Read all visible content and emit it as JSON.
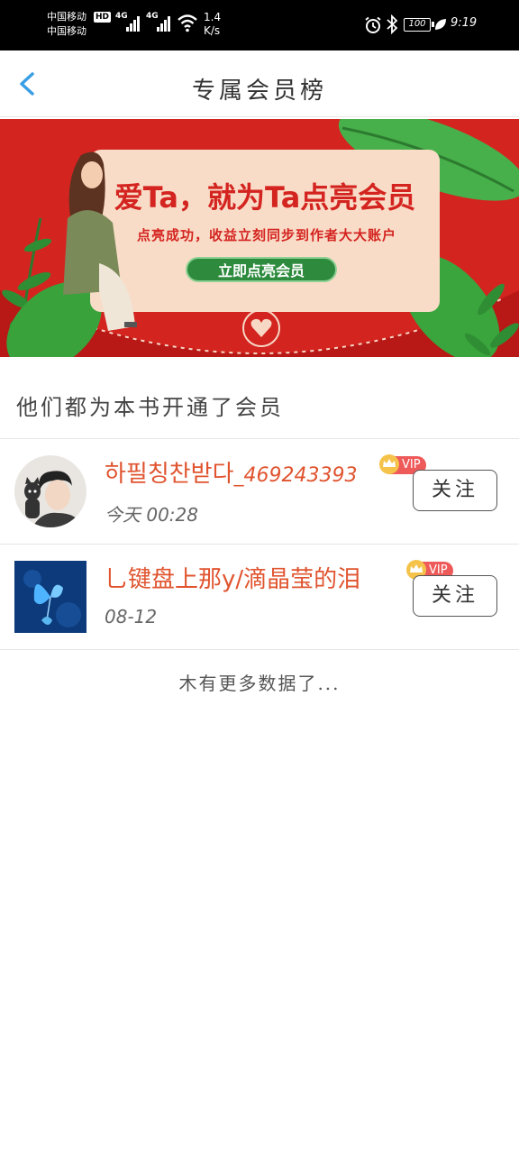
{
  "status_bar": {
    "carrier_1": "中国移动",
    "carrier_2": "中国移动",
    "hd": "HD",
    "network_1": "4G",
    "network_2": "4G",
    "speed_value": "1.4",
    "speed_unit": "K/s",
    "battery": "100",
    "time": "9:19",
    "icons": [
      "signal-icon",
      "wifi-icon",
      "alarm-icon",
      "bluetooth-icon",
      "battery-icon",
      "leaf-icon"
    ]
  },
  "header": {
    "title": "专属会员榜",
    "back_icon": "chevron-left-icon"
  },
  "banner": {
    "headline": "爱Ta，就为Ta点亮会员",
    "subtitle": "点亮成功，收益立刻同步到作者大大账户",
    "cta": "立即点亮会员",
    "colors": {
      "background": "#d42420",
      "card": "#f9dcc7",
      "cta": "#2e8b3e"
    }
  },
  "section": {
    "title": "他们都为本书开通了会员"
  },
  "members": [
    {
      "name": "하필칭찬받다",
      "uid": "_469243393",
      "badge": "VIP",
      "time": "今天 00:28",
      "follow": "关注",
      "avatar": "avatar-boy-with-cat"
    },
    {
      "name": "乚键盘上那y/滴晶莹的泪",
      "badge": "VIP",
      "time": "08-12",
      "follow": "关注",
      "avatar": "avatar-blue-butterfly"
    }
  ],
  "footer": {
    "no_more": "木有更多数据了..."
  },
  "colors": {
    "accent_blue": "#3a9ee4",
    "name_red": "#e0542f",
    "vip_red": "#ee5a5a"
  }
}
